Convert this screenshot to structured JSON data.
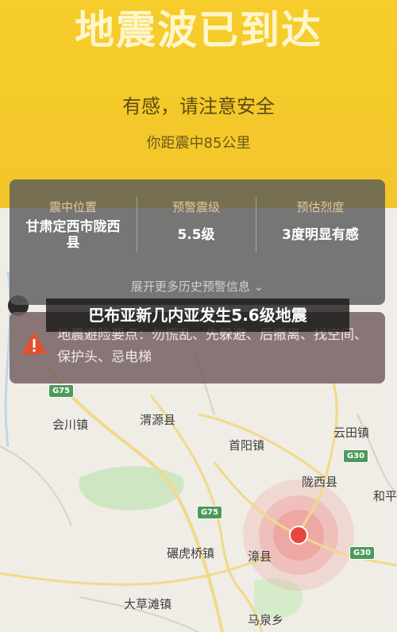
{
  "header": {
    "title": "地震波已到达",
    "subtitle": "有感，请注意安全",
    "distance": "你距震中85公里"
  },
  "info_card": {
    "columns": [
      {
        "label": "震中位置",
        "value": "甘肃定西市陇西县"
      },
      {
        "label": "预警震级",
        "value": "5.5级"
      },
      {
        "label": "预估烈度",
        "value": "3度明显有感"
      }
    ],
    "expand_label": "展开更多历史预警信息",
    "expand_icon": "chevron-down-icon"
  },
  "notice": {
    "icon": "warning-icon",
    "icon_color": "#e4502f",
    "text": "地震避险要点：勿慌乱、先躲避、后撤离、找空间、保护头、忌电梯"
  },
  "caption": "巴布亚新几内亚发生5.6级地震",
  "map": {
    "places": [
      "会川镇",
      "渭源县",
      "首阳镇",
      "云田镇",
      "陇西县",
      "和平",
      "碾虎桥镇",
      "漳县",
      "大草滩镇",
      "马泉乡"
    ],
    "road_shields": [
      "G75",
      "G30",
      "G75",
      "G30"
    ],
    "epicenter_color": "#e8453c"
  }
}
